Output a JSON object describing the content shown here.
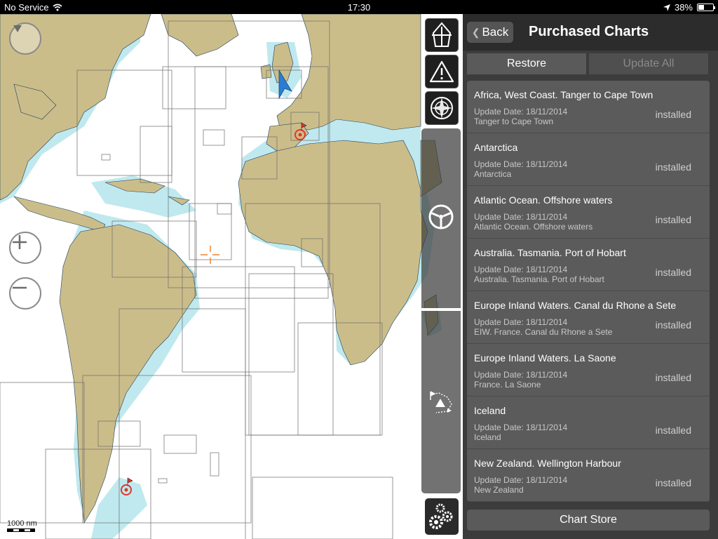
{
  "status_bar": {
    "carrier": "No Service",
    "time": "17:30",
    "battery": "38%",
    "battery_level": 0.38
  },
  "map": {
    "scale_label": "1000 nm"
  },
  "toolbar": {
    "icons": [
      "boat-icon",
      "warning-icon",
      "compass-icon",
      "helm-icon",
      "route-icon",
      "settings-icon"
    ]
  },
  "panel": {
    "back_label": "Back",
    "title": "Purchased Charts",
    "restore_label": "Restore",
    "update_all_label": "Update All",
    "store_label": "Chart Store",
    "charts": [
      {
        "title": "Africa, West Coast. Tanger to Cape Town",
        "date": "Update Date: 18/11/2014",
        "subtitle": "Tanger to Cape Town",
        "status": "installed"
      },
      {
        "title": "Antarctica",
        "date": "Update Date: 18/11/2014",
        "subtitle": "Antarctica",
        "status": "installed"
      },
      {
        "title": "Atlantic Ocean. Offshore waters",
        "date": "Update Date: 18/11/2014",
        "subtitle": "Atlantic Ocean. Offshore waters",
        "status": "installed"
      },
      {
        "title": "Australia. Tasmania. Port of Hobart",
        "date": "Update Date: 18/11/2014",
        "subtitle": "Australia. Tasmania. Port of Hobart",
        "status": "installed"
      },
      {
        "title": "Europe Inland Waters. Canal du Rhone a Sete",
        "date": "Update Date: 18/11/2014",
        "subtitle": "EIW. France. Canal du Rhone a Sete",
        "status": "installed"
      },
      {
        "title": "Europe Inland Waters. La Saone",
        "date": "Update Date: 18/11/2014",
        "subtitle": "France. La Saone",
        "status": "installed"
      },
      {
        "title": "Iceland",
        "date": "Update Date: 18/11/2014",
        "subtitle": "Iceland",
        "status": "installed"
      },
      {
        "title": "New Zealand. Wellington Harbour",
        "date": "Update Date: 18/11/2014",
        "subtitle": "New Zealand",
        "status": "installed"
      }
    ]
  },
  "colors": {
    "land": "#cbbd8a",
    "shallow_water": "#bfe9ee",
    "deep_water": "#ffffff",
    "panel_bg": "#3c3c3c",
    "list_bg": "#5b5b5b",
    "vessel": "#2c7cd1",
    "marker": "#e0362b"
  }
}
